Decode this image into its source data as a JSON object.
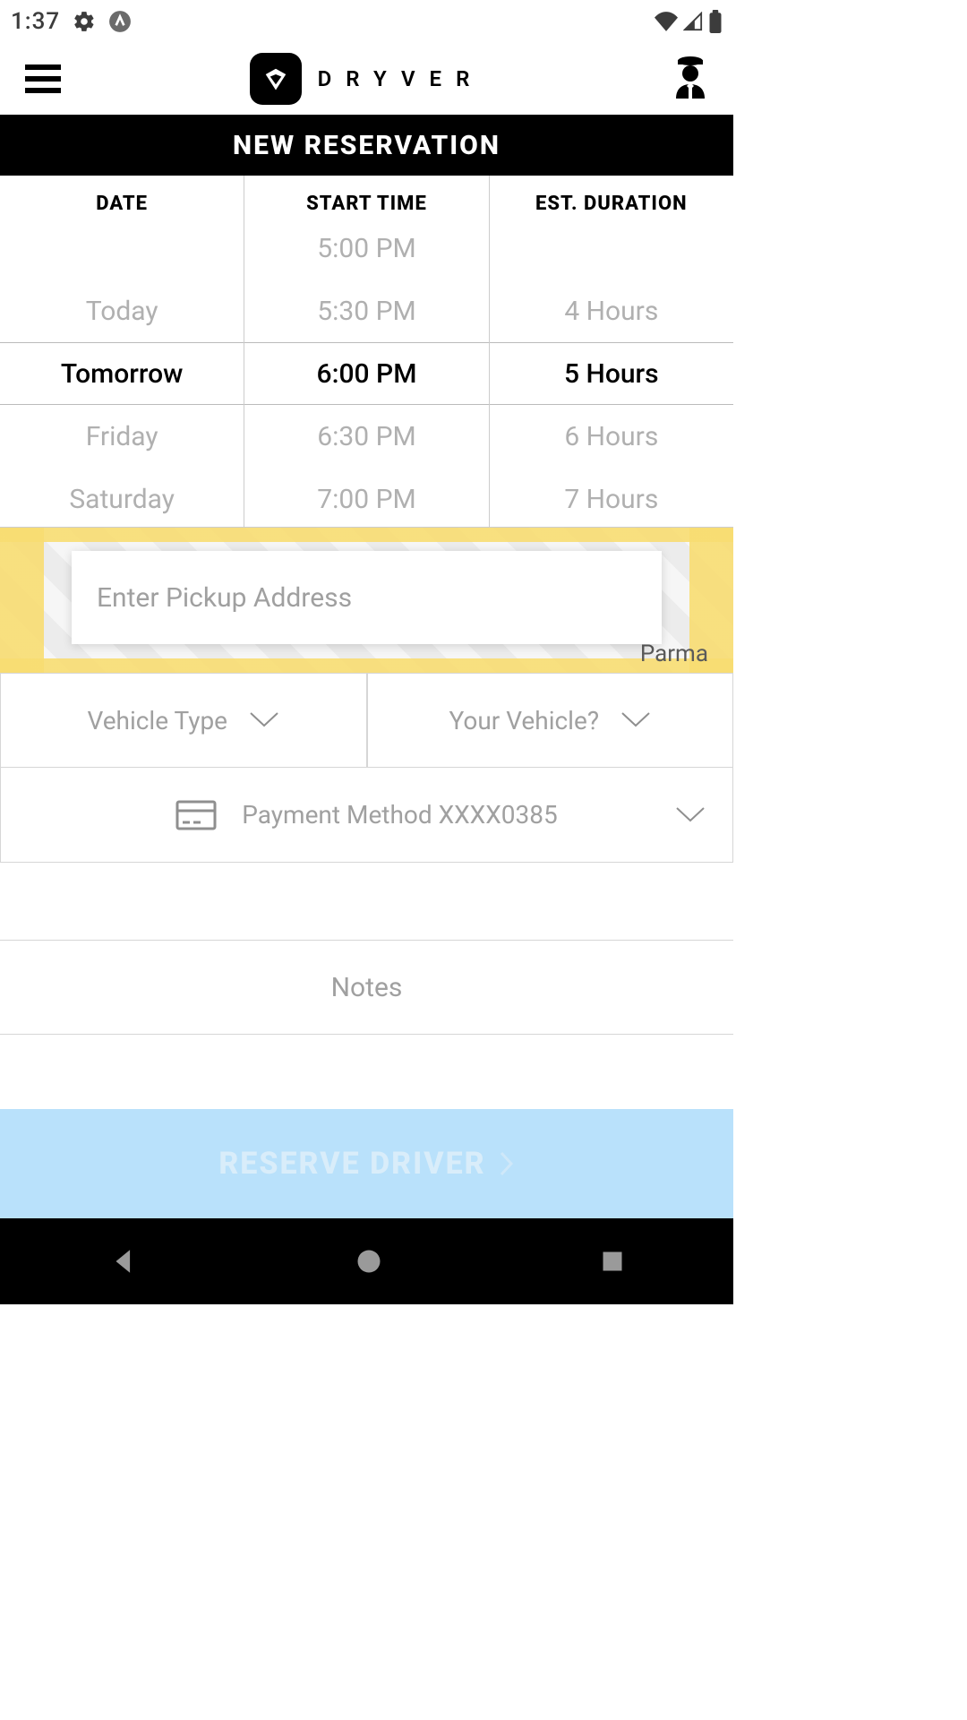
{
  "status": {
    "time": "1:37"
  },
  "header": {
    "brand": "DRYVER"
  },
  "title": "NEW RESERVATION",
  "picker": {
    "date": {
      "label": "DATE",
      "options": [
        "",
        "Today",
        "Tomorrow",
        "Friday",
        "Saturday"
      ],
      "selected_index": 2
    },
    "start_time": {
      "label": "START TIME",
      "options": [
        "5:00 PM",
        "5:30 PM",
        "6:00 PM",
        "6:30 PM",
        "7:00 PM"
      ],
      "selected_index": 2
    },
    "duration": {
      "label": "EST. DURATION",
      "options": [
        "",
        "4 Hours",
        "5 Hours",
        "6 Hours",
        "7 Hours"
      ],
      "selected_index": 2
    }
  },
  "address": {
    "placeholder": "Enter Pickup Address",
    "map_city": "Parma"
  },
  "selects": {
    "vehicle_type": "Vehicle Type",
    "your_vehicle": "Your Vehicle?",
    "payment": "Payment Method XXXX0385"
  },
  "notes_label": "Notes",
  "reserve_label": "RESERVE DRIVER"
}
